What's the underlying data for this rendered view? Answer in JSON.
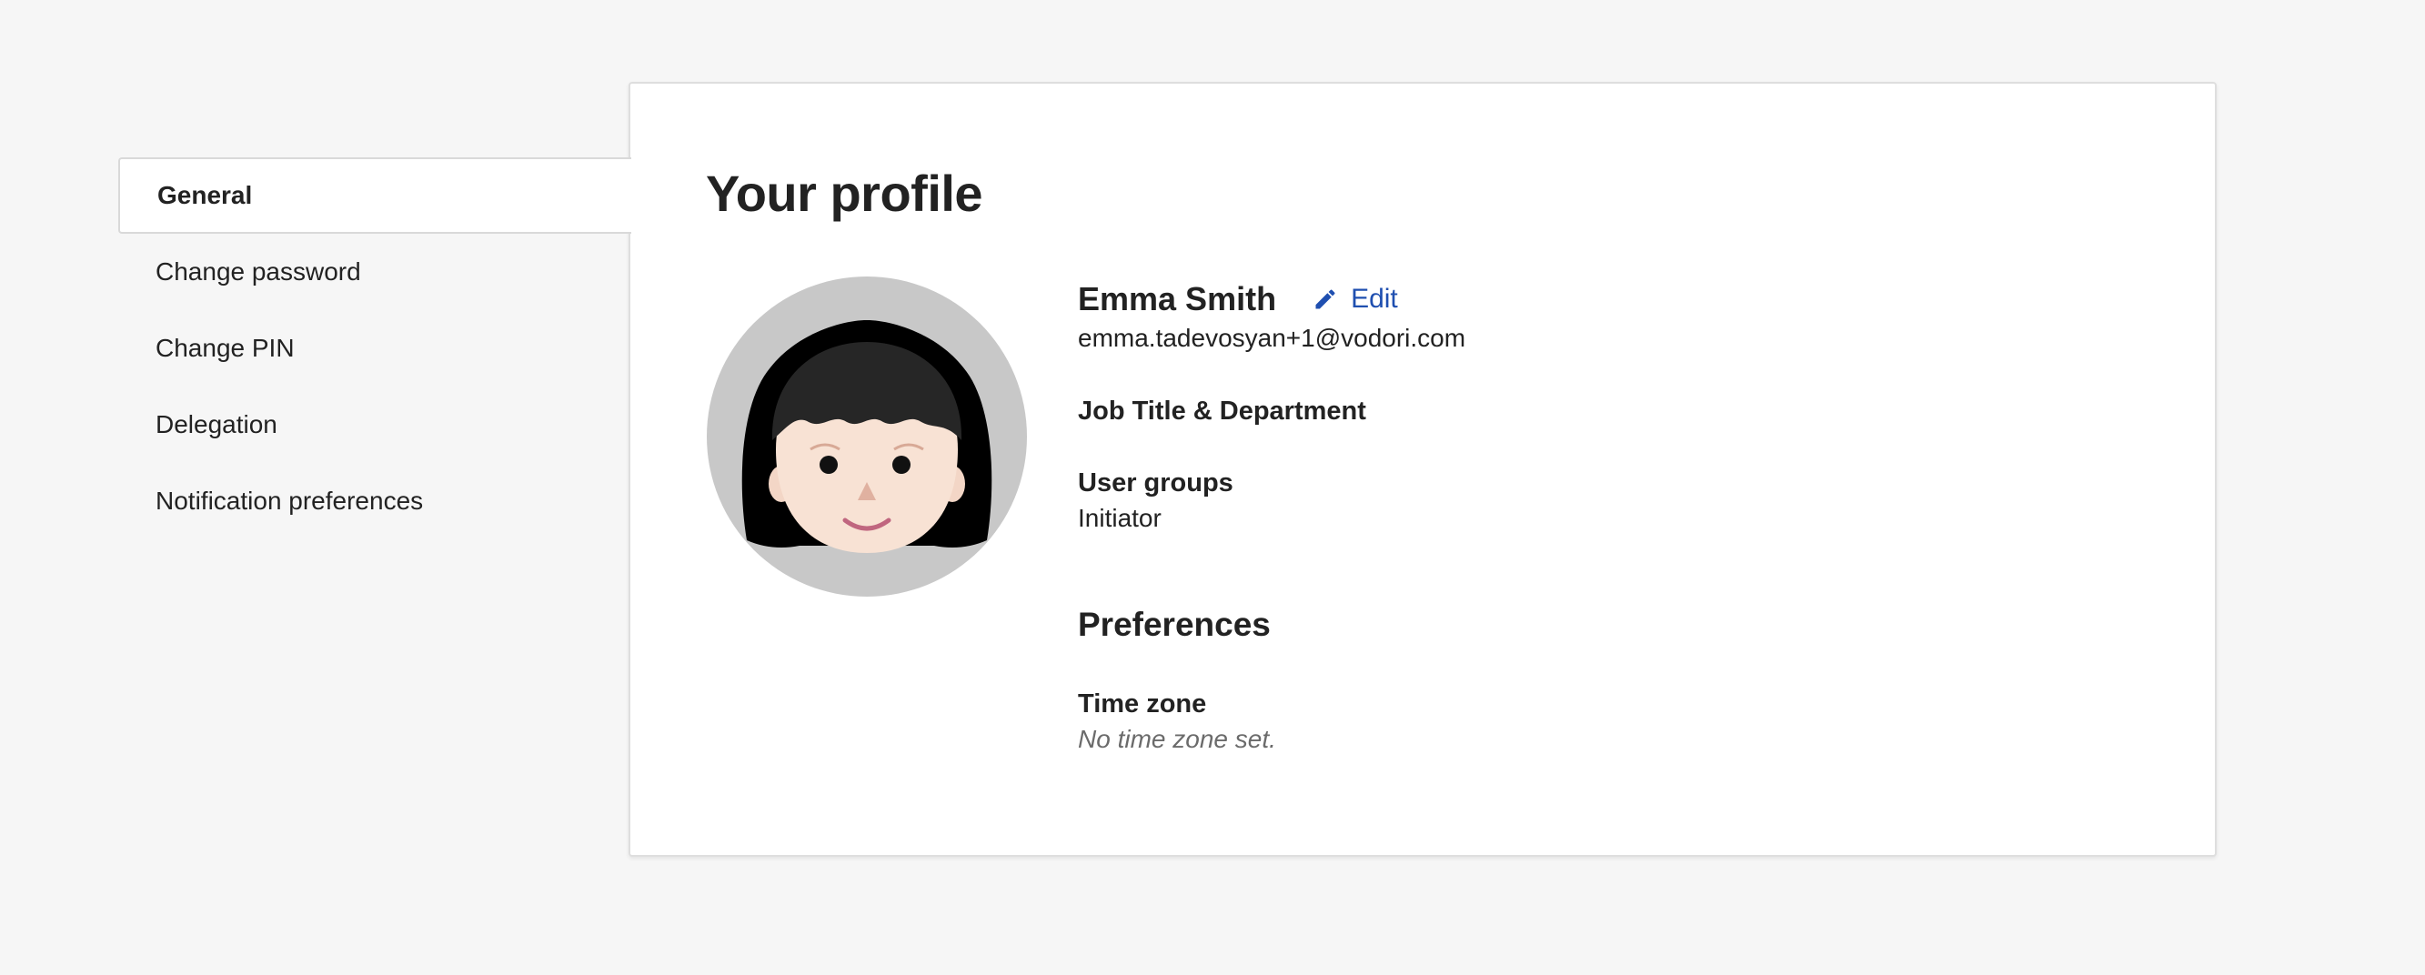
{
  "sidebar": {
    "items": [
      {
        "label": "General",
        "active": true
      },
      {
        "label": "Change password",
        "active": false
      },
      {
        "label": "Change PIN",
        "active": false
      },
      {
        "label": "Delegation",
        "active": false
      },
      {
        "label": "Notification preferences",
        "active": false
      }
    ]
  },
  "profile": {
    "title": "Your profile",
    "name": "Emma Smith",
    "edit_label": "Edit",
    "email": "emma.tadevosyan+1@vodori.com",
    "job_title_label": "Job Title & Department",
    "user_groups_label": "User groups",
    "user_groups_value": "Initiator"
  },
  "preferences": {
    "title": "Preferences",
    "time_zone_label": "Time zone",
    "time_zone_value": "No time zone set."
  },
  "icons": {
    "edit": "pencil-icon",
    "avatar": "user-avatar-illustration"
  },
  "colors": {
    "accent": "#1f4fb0",
    "background": "#f6f6f6",
    "panel": "#ffffff"
  }
}
